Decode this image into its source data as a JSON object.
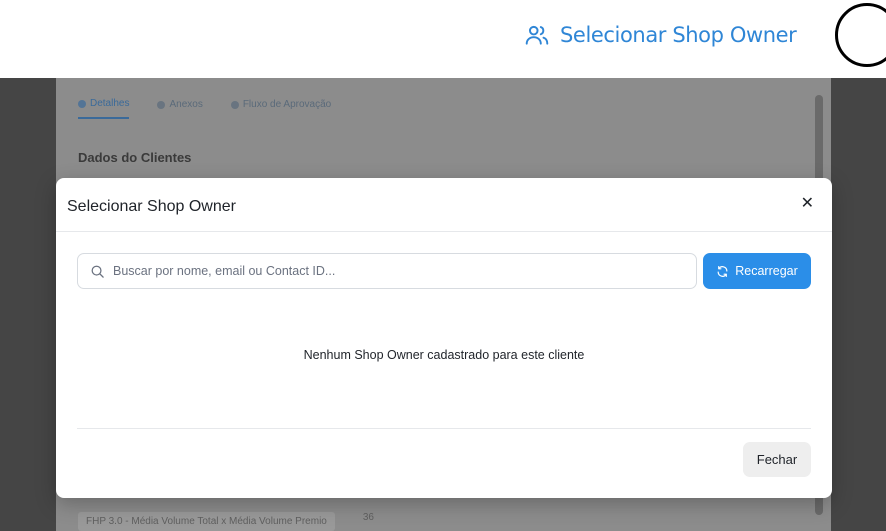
{
  "header": {
    "select_shop_owner_label": "Selecionar Shop Owner",
    "icon": "users-icon"
  },
  "background_page": {
    "tabs": [
      "Detalhes",
      "Anexos",
      "Fluxo de Aprovação"
    ],
    "section_title": "Dados do Clientes",
    "row_text": "FHP 3.0 - Média Volume Total x Média Volume Premio",
    "row_value": "36"
  },
  "modal": {
    "title": "Selecionar Shop Owner",
    "close_icon": "close-icon",
    "search": {
      "placeholder": "Buscar por nome, email ou Contact ID...",
      "value": ""
    },
    "reload_label": "Recarregar",
    "empty_message": "Nenhum Shop Owner cadastrado para este cliente",
    "footer_close_label": "Fechar"
  },
  "colors": {
    "accent": "#2b8ee8",
    "header_link": "#2f86d6",
    "overlay": "#454545"
  }
}
